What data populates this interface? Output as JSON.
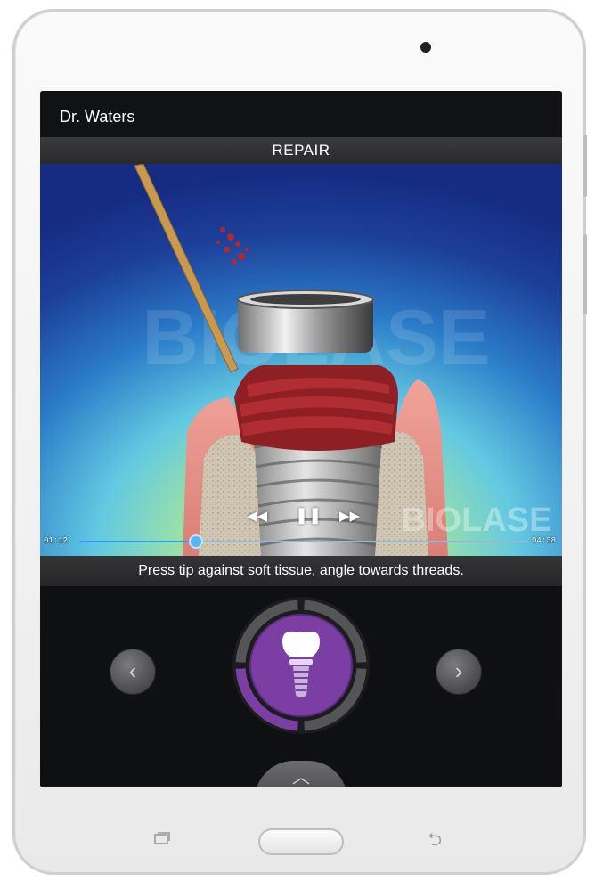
{
  "header": {
    "user_name": "Dr. Waters",
    "section_title": "REPAIR"
  },
  "video": {
    "watermark_center": "BIOLASE",
    "watermark_corner": "BIOLASE",
    "current_time": "01:12",
    "duration": "04:38",
    "progress_fraction": 0.26,
    "rewind_icon": "rewind-icon",
    "pause_icon": "pause-icon",
    "forward_icon": "fast-forward-icon"
  },
  "instruction": {
    "text": "Press tip against soft tissue, angle towards threads."
  },
  "navigation": {
    "prev_icon": "chevron-left-icon",
    "next_icon": "chevron-right-icon",
    "up_icon": "chevron-up-icon",
    "center_icon": "dental-implant-icon",
    "progress_segments_total": 4,
    "progress_segments_done": 1,
    "accent_color": "#7b3fa3"
  },
  "device": {
    "recent_icon": "recent-apps-icon",
    "home_icon": "home-button",
    "back_icon": "back-icon"
  },
  "colors": {
    "screen_bg": "#0f1012",
    "accent_blue": "#2f9ee6",
    "accent_purple": "#7b3fa3"
  }
}
